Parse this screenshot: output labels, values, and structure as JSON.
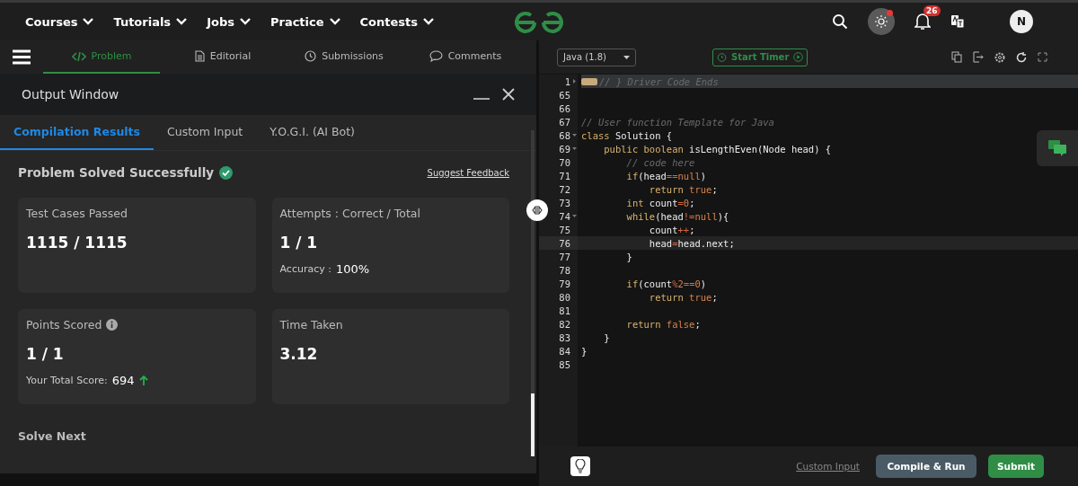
{
  "nav": {
    "menus": [
      {
        "label": "Courses"
      },
      {
        "label": "Tutorials"
      },
      {
        "label": "Jobs"
      },
      {
        "label": "Practice"
      },
      {
        "label": "Contests"
      }
    ],
    "notifications": "26",
    "avatar": "N"
  },
  "problem_tabs": [
    {
      "label": "Problem",
      "selected": true
    },
    {
      "label": "Editorial",
      "selected": false
    },
    {
      "label": "Submissions",
      "selected": false
    },
    {
      "label": "Comments",
      "selected": false
    }
  ],
  "output": {
    "title": "Output Window",
    "tabs": [
      {
        "label": "Compilation Results",
        "selected": true
      },
      {
        "label": "Custom Input",
        "selected": false
      },
      {
        "label": "Y.O.G.I. (AI Bot)",
        "selected": false
      }
    ],
    "status": "Problem Solved Successfully",
    "feedback": "Suggest Feedback",
    "cards": [
      {
        "title": "Test Cases Passed",
        "value": "1115 / 1115"
      },
      {
        "title": "Attempts : Correct / Total",
        "value": "1 / 1",
        "detail_label": "Accuracy :",
        "detail_value": "100%"
      },
      {
        "title": "Points Scored",
        "info": true,
        "value": "1 / 1",
        "detail_label": "Your Total Score:",
        "detail_value": "694"
      },
      {
        "title": "Time Taken",
        "value": "3.12"
      }
    ],
    "next": "Solve Next"
  },
  "editor": {
    "language": "Java (1.8)",
    "timer": "Start Timer",
    "lines": [
      {
        "number": "1",
        "foldable": true,
        "folded": true,
        "active": false,
        "tokens": [
          {
            "kind": "comment",
            "text": "// } Driver Code Ends"
          }
        ]
      },
      {
        "number": "65",
        "foldable": false,
        "folded": false,
        "active": false
      },
      {
        "number": "66",
        "foldable": false,
        "folded": false,
        "active": false
      },
      {
        "number": "67",
        "foldable": false,
        "folded": false,
        "active": false,
        "tokens": [
          {
            "kind": "comment",
            "text": "// User function Template for Java"
          }
        ]
      },
      {
        "number": "68",
        "foldable": true,
        "folded": false,
        "active": false,
        "tokens": [
          {
            "kind": "kw",
            "text": "class"
          },
          {
            "kind": "plain",
            "text": " Solution {"
          }
        ]
      },
      {
        "number": "69",
        "foldable": true,
        "folded": false,
        "active": false,
        "tokens": [
          {
            "kind": "kw",
            "text": "    public"
          },
          {
            "kind": "kw",
            "text": " boolean"
          },
          {
            "kind": "plain",
            "text": " isLengthEven(Node head) {"
          }
        ]
      },
      {
        "number": "70",
        "foldable": false,
        "folded": false,
        "active": false,
        "tokens": [
          {
            "kind": "comment",
            "text": "        // code here"
          }
        ]
      },
      {
        "number": "71",
        "foldable": false,
        "folded": false,
        "active": false,
        "tokens": [
          {
            "kind": "kw",
            "text": "        if"
          },
          {
            "kind": "plain",
            "text": "(head"
          },
          {
            "kind": "op",
            "text": "=="
          },
          {
            "kind": "lit",
            "text": "null"
          },
          {
            "kind": "plain",
            "text": ")"
          }
        ]
      },
      {
        "number": "72",
        "foldable": false,
        "folded": false,
        "active": false,
        "tokens": [
          {
            "kind": "kw",
            "text": "            return"
          },
          {
            "kind": "lit",
            "text": " true"
          },
          {
            "kind": "plain",
            "text": ";"
          }
        ]
      },
      {
        "number": "73",
        "foldable": false,
        "folded": false,
        "active": false,
        "tokens": [
          {
            "kind": "kw",
            "text": "        int"
          },
          {
            "kind": "plain",
            "text": " count"
          },
          {
            "kind": "op",
            "text": "="
          },
          {
            "kind": "lit",
            "text": "0"
          },
          {
            "kind": "plain",
            "text": ";"
          }
        ]
      },
      {
        "number": "74",
        "foldable": true,
        "folded": false,
        "active": false,
        "tokens": [
          {
            "kind": "kw",
            "text": "        while"
          },
          {
            "kind": "plain",
            "text": "(head"
          },
          {
            "kind": "op",
            "text": "!="
          },
          {
            "kind": "lit",
            "text": "null"
          },
          {
            "kind": "plain",
            "text": "){"
          }
        ]
      },
      {
        "number": "75",
        "foldable": false,
        "folded": false,
        "active": false,
        "tokens": [
          {
            "kind": "plain",
            "text": "            count"
          },
          {
            "kind": "op",
            "text": "++"
          },
          {
            "kind": "plain",
            "text": ";"
          }
        ]
      },
      {
        "number": "76",
        "foldable": false,
        "folded": false,
        "active": true,
        "tokens": [
          {
            "kind": "plain",
            "text": "            head"
          },
          {
            "kind": "op",
            "text": "="
          },
          {
            "kind": "plain",
            "text": "head.next;"
          }
        ]
      },
      {
        "number": "77",
        "foldable": false,
        "folded": false,
        "active": false,
        "tokens": [
          {
            "kind": "plain",
            "text": "        }"
          }
        ]
      },
      {
        "number": "78",
        "foldable": false,
        "folded": false,
        "active": false
      },
      {
        "number": "79",
        "foldable": false,
        "folded": false,
        "active": false,
        "tokens": [
          {
            "kind": "kw",
            "text": "        if"
          },
          {
            "kind": "plain",
            "text": "(count"
          },
          {
            "kind": "op",
            "text": "%"
          },
          {
            "kind": "lit",
            "text": "2"
          },
          {
            "kind": "op",
            "text": "=="
          },
          {
            "kind": "lit",
            "text": "0"
          },
          {
            "kind": "plain",
            "text": ")"
          }
        ]
      },
      {
        "number": "80",
        "foldable": false,
        "folded": false,
        "active": false,
        "tokens": [
          {
            "kind": "kw",
            "text": "            return"
          },
          {
            "kind": "lit",
            "text": " true"
          },
          {
            "kind": "plain",
            "text": ";"
          }
        ]
      },
      {
        "number": "81",
        "foldable": false,
        "folded": false,
        "active": false
      },
      {
        "number": "82",
        "foldable": false,
        "folded": false,
        "active": false,
        "tokens": [
          {
            "kind": "kw",
            "text": "        return"
          },
          {
            "kind": "lit",
            "text": " false"
          },
          {
            "kind": "plain",
            "text": ";"
          }
        ]
      },
      {
        "number": "83",
        "foldable": false,
        "folded": false,
        "active": false,
        "tokens": [
          {
            "kind": "plain",
            "text": "    }"
          }
        ]
      },
      {
        "number": "84",
        "foldable": false,
        "folded": false,
        "active": false,
        "tokens": [
          {
            "kind": "plain",
            "text": "}"
          }
        ]
      },
      {
        "number": "85",
        "foldable": false,
        "folded": false,
        "active": false
      }
    ],
    "custom_input": "Custom Input",
    "compile": "Compile & Run",
    "submit": "Submit"
  }
}
